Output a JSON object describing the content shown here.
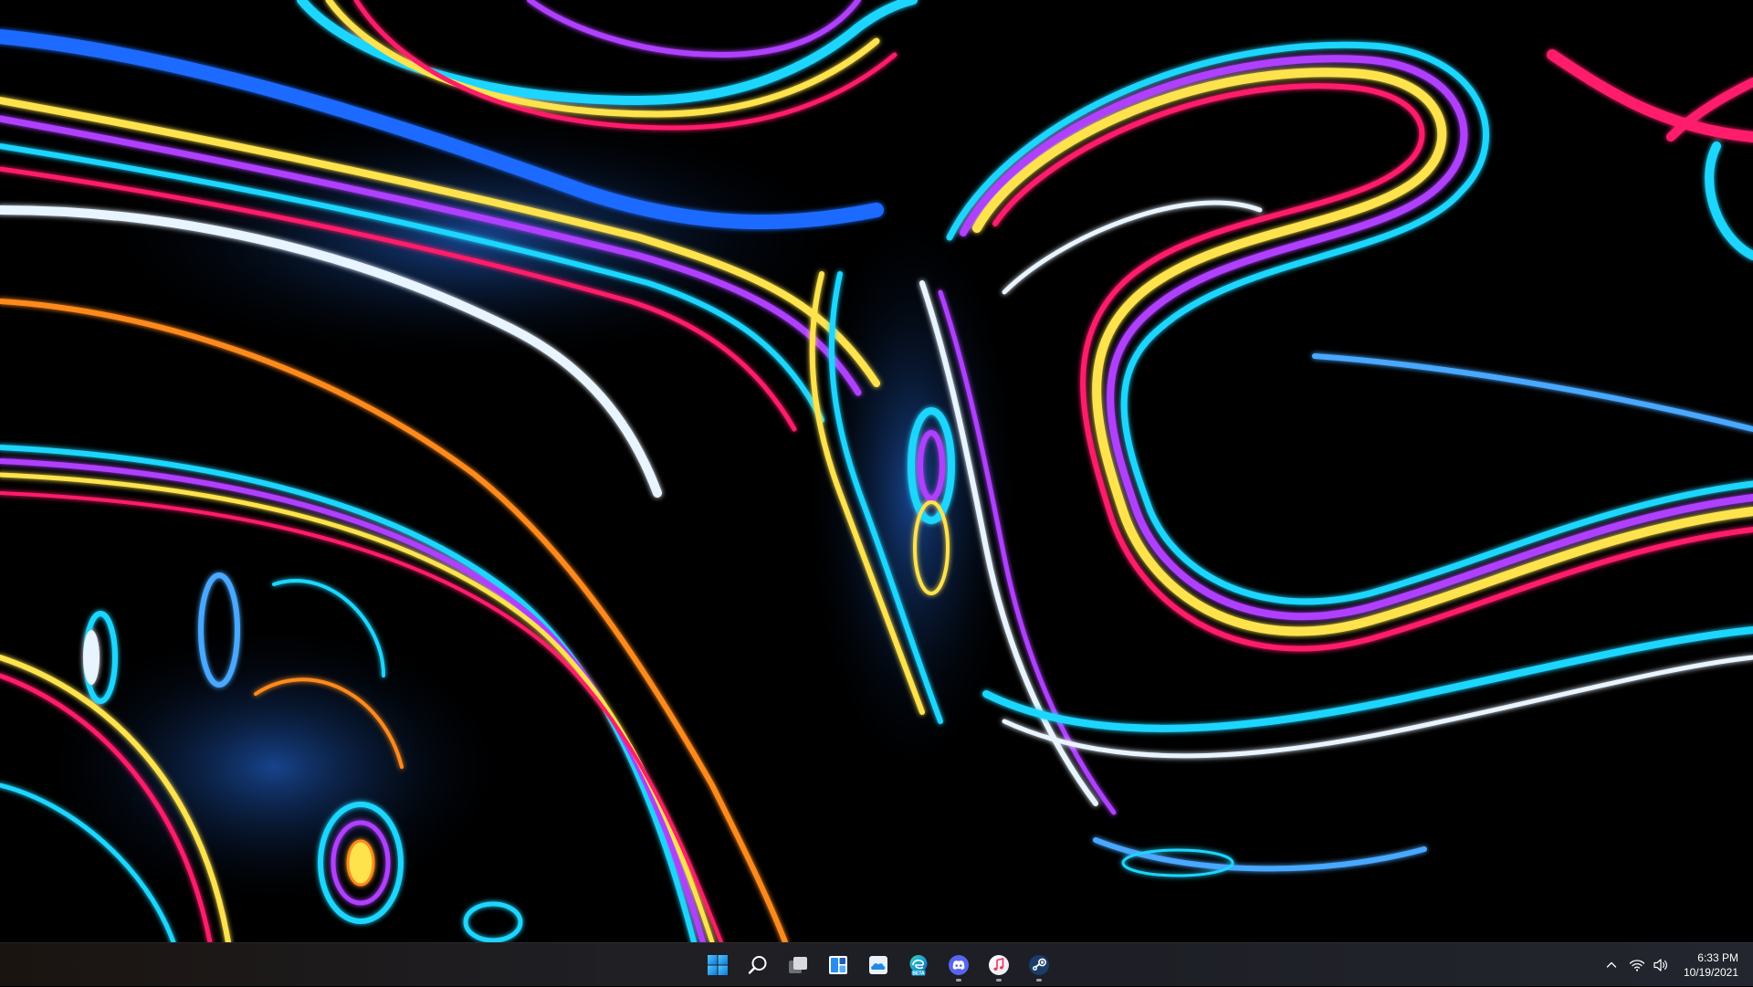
{
  "desktop": {
    "wallpaper": {
      "name": "abstract-neon-swirl-wallpaper",
      "colors": [
        "#000000",
        "#ff1f6b",
        "#ffe34d",
        "#b040ff",
        "#1ed6ff",
        "#ff8a1c",
        "#1a6bff",
        "#ffffff"
      ]
    }
  },
  "taskbar": {
    "pinned": [
      {
        "name": "start-button",
        "icon": "windows-logo-icon",
        "running": false
      },
      {
        "name": "search-button",
        "icon": "search-icon",
        "running": false
      },
      {
        "name": "task-view-button",
        "icon": "task-view-icon",
        "running": false
      },
      {
        "name": "widgets-button",
        "icon": "widgets-icon",
        "running": false
      },
      {
        "name": "onedrive-button",
        "icon": "onedrive-icon",
        "running": false
      },
      {
        "name": "edge-beta-button",
        "icon": "edge-beta-icon",
        "badge": "BETA",
        "running": false
      },
      {
        "name": "discord-button",
        "icon": "discord-icon",
        "running": true
      },
      {
        "name": "itunes-button",
        "icon": "music-icon",
        "running": true
      },
      {
        "name": "steam-button",
        "icon": "steam-icon",
        "running": true
      }
    ],
    "tray": {
      "overflow_icon": "chevron-up-icon",
      "wifi_icon": "wifi-icon",
      "volume_icon": "volume-icon"
    },
    "clock": {
      "time": "6:33 PM",
      "date": "10/19/2021"
    },
    "accent": "#0078d4"
  }
}
